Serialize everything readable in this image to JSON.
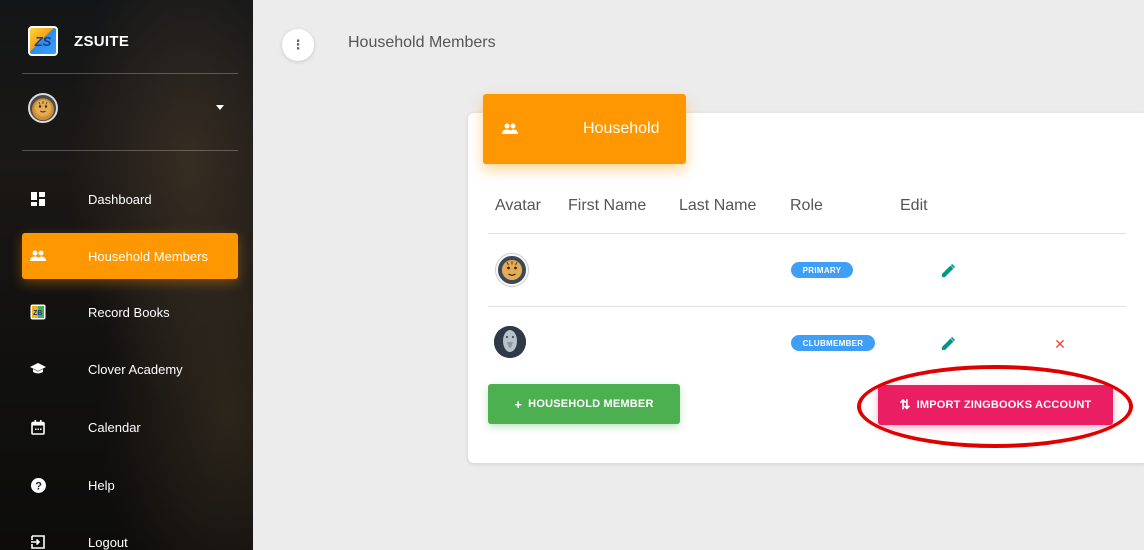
{
  "brand": {
    "logo_text": "ZS",
    "name": "ZSUITE"
  },
  "sidebar": {
    "items": [
      {
        "key": "dashboard",
        "label": "Dashboard",
        "icon": "dashboard-icon",
        "active": false
      },
      {
        "key": "household-members",
        "label": "Household Members",
        "icon": "people-icon",
        "active": true
      },
      {
        "key": "record-books",
        "label": "Record Books",
        "icon": "zs-book-icon",
        "active": false
      },
      {
        "key": "clover-academy",
        "label": "Clover Academy",
        "icon": "graduation-cap-icon",
        "active": false
      },
      {
        "key": "calendar",
        "label": "Calendar",
        "icon": "calendar-icon",
        "active": false
      },
      {
        "key": "help",
        "label": "Help",
        "icon": "help-icon",
        "active": false
      },
      {
        "key": "logout",
        "label": "Logout",
        "icon": "logout-icon",
        "active": false
      }
    ]
  },
  "header": {
    "menu_glyph": "⋮",
    "title": "Household Members"
  },
  "card": {
    "title": "Household",
    "columns": [
      "Avatar",
      "First Name",
      "Last Name",
      "Role",
      "Edit"
    ],
    "rows": [
      {
        "avatar": "tiger-avatar",
        "first_name": "",
        "last_name": "",
        "role": "PRIMARY",
        "can_delete": false
      },
      {
        "avatar": "elephant-avatar",
        "first_name": "",
        "last_name": "",
        "role": "CLUBMEMBER",
        "can_delete": true
      }
    ],
    "add_button": {
      "glyph": "+",
      "label": "HOUSEHOLD MEMBER"
    },
    "import_button": {
      "glyph": "⇅",
      "label": "IMPORT ZINGBOOKS ACCOUNT"
    },
    "delete_glyph": "✕"
  },
  "colors": {
    "accent": "#ff9800",
    "badge": "#3f9ef5",
    "add_button": "#4caf50",
    "import_button": "#e91e63",
    "edit_icon": "#009688",
    "delete_icon": "#f44336",
    "highlight": "#e00000"
  }
}
